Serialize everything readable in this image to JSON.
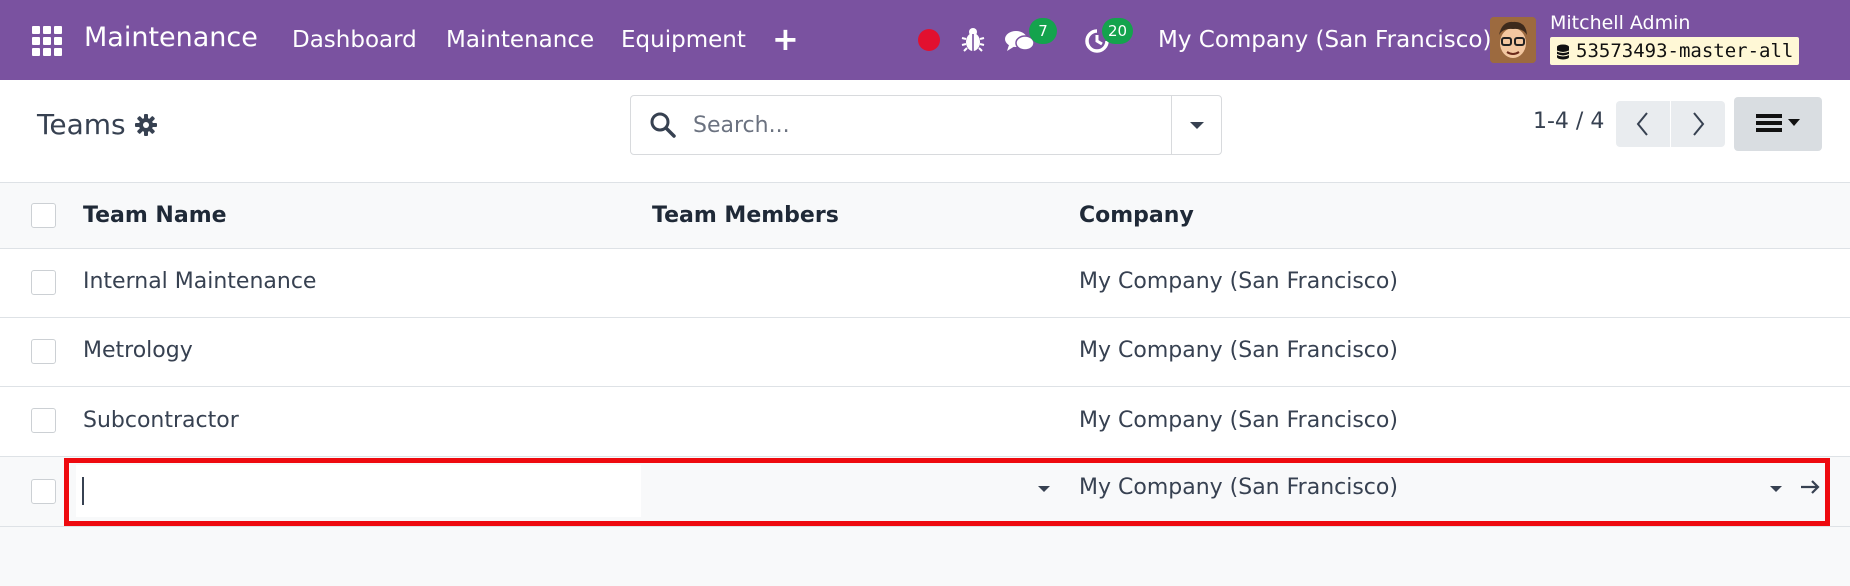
{
  "navbar": {
    "brand": "Maintenance",
    "menu": [
      "Dashboard",
      "Maintenance",
      "Equipment"
    ],
    "add_symbol": "+",
    "chat_count": "7",
    "activity_count": "20",
    "company": "My Company (San Francisco)",
    "user_name": "Mitchell Admin",
    "database": "53573493-master-all",
    "colors": {
      "brand_bg": "#7a52a0",
      "badge": "#14a34d",
      "record_dot": "#e2102f"
    }
  },
  "control_panel": {
    "title": "Teams",
    "search_placeholder": "Search...",
    "pager": "1-4 / 4"
  },
  "table": {
    "columns": [
      "Team Name",
      "Team Members",
      "Company"
    ],
    "rows": [
      {
        "team_name": "Internal Maintenance",
        "team_members": "",
        "company": "My Company (San Francisco)"
      },
      {
        "team_name": "Metrology",
        "team_members": "",
        "company": "My Company (San Francisco)"
      },
      {
        "team_name": "Subcontractor",
        "team_members": "",
        "company": "My Company (San Francisco)"
      }
    ],
    "new_row": {
      "team_name": "",
      "team_members": "",
      "company": "My Company (San Francisco)"
    },
    "highlight_color": "#ee0a0f"
  }
}
